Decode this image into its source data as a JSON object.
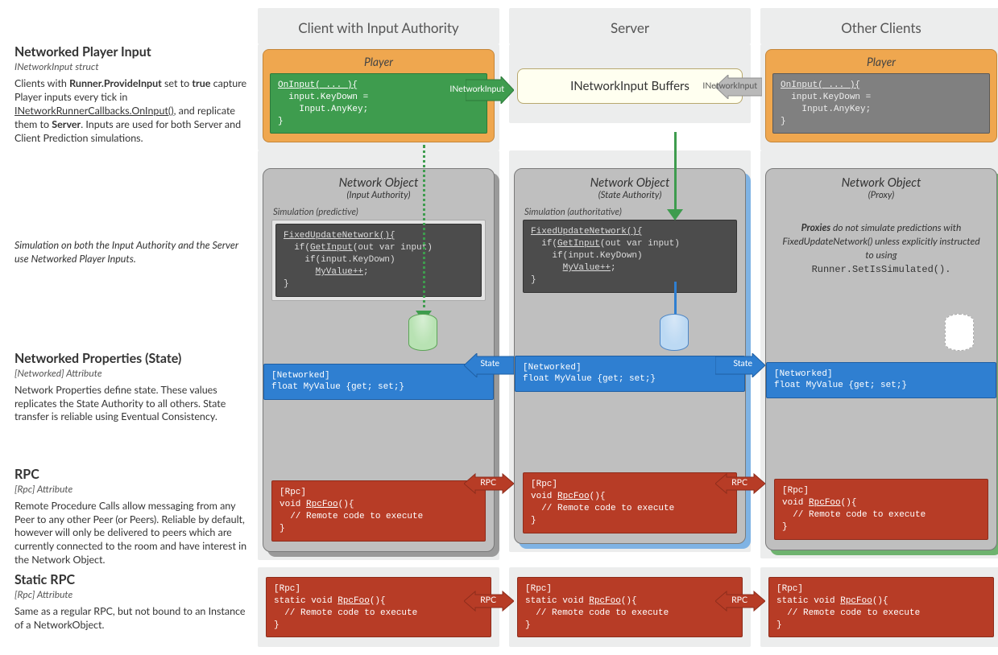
{
  "columns": {
    "client": "Client with Input Authority",
    "server": "Server",
    "others": "Other Clients"
  },
  "player": {
    "title": "Player",
    "code_oninput": "OnInput( ... ){\n  input.KeyDown =\n    Input.AnyKey;\n}",
    "inetlabel": "INetworkInput",
    "buffers": "INetworkInput Buffers"
  },
  "netobj": {
    "title": "Network Object",
    "input_auth": "(Input Authority)",
    "state_auth": "(State Authority)",
    "proxy": "(Proxy)",
    "sim_pred": "Simulation (predictive)",
    "sim_auth": "Simulation (authoritative)",
    "code_fun": "FixedUpdateNetwork(){\n  if(GetInput(out var input)\n    if(input.KeyDown)\n      MyValue++;\n}",
    "code_state": "[Networked]\nfloat MyValue {get; set;}",
    "code_rpc": "[Rpc]\nvoid RpcFoo(){\n  // Remote code to execute\n}",
    "code_srpc": "[Rpc]\nstatic void RpcFoo(){\n  // Remote code to execute\n}",
    "state_arrow": "State",
    "rpc_arrow": "RPC",
    "proxy_note_a": "Proxies",
    "proxy_note_b": " do not simulate predictions with ",
    "proxy_note_c": "FixedUpdateNetwork()",
    "proxy_note_d": " unless explicitly instructed to using ",
    "proxy_note_e": "Runner.SetIsSimulated()."
  },
  "side": {
    "s1_h": "Networked Player Input",
    "s1_sub": "INetworkInput struct",
    "s1_body": "Clients with <b>Runner.ProvideInput</b> set to <b>true</b> capture Player inputs every tick in <u>INetworkRunnerCallbacks.OnInput()</u>, and replicate them to <b>Server</b>. Inputs are used for both Server and Client Prediction simulations.",
    "s2_body": "Simulation on both the Input Authority and the Server use Networked Player Inputs.",
    "s3_h": "Networked Properties (State)",
    "s3_sub": "[Networked] Attribute",
    "s3_body": "Network Properties define state. These values replicates the State Authority to all others. State transfer is reliable using Eventual Consistency.",
    "s4_h": "RPC",
    "s4_sub": "[Rpc] Attribute",
    "s4_body": "Remote Procedure Calls allow messaging from any Peer to any other Peer (or Peers). Reliable by default, however will only be delivered to peers which are currently connected to the room and have interest in  the Network Object.",
    "s5_h": "Static RPC",
    "s5_sub": "[Rpc] Attribute",
    "s5_body": "Same as a regular RPC, but not bound to an Instance of a NetworkObject."
  }
}
